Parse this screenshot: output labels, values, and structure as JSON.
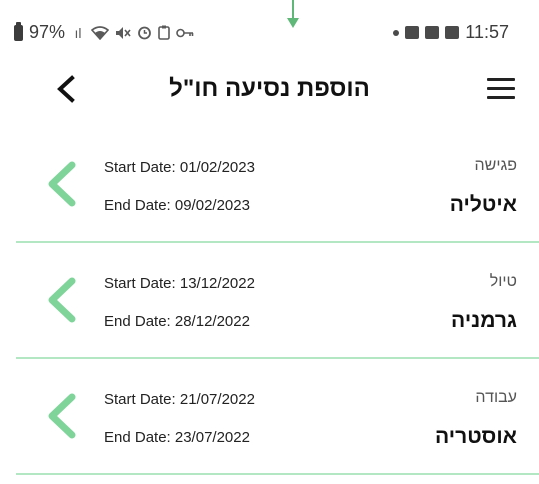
{
  "status_bar": {
    "battery": "97%",
    "time": "11:57"
  },
  "header": {
    "title": "הוספת נסיעה חו\"ל"
  },
  "trips": [
    {
      "type": "פגישה",
      "country": "איטליה",
      "start": "Start Date: 01/02/2023",
      "end": "End Date: 09/02/2023"
    },
    {
      "type": "טיול",
      "country": "גרמניה",
      "start": "Start Date: 13/12/2022",
      "end": "End Date: 28/12/2022"
    },
    {
      "type": "עבודה",
      "country": "אוסטריה",
      "start": "Start Date: 21/07/2022",
      "end": "End Date: 23/07/2022"
    }
  ],
  "colors": {
    "accent": "#7fd49a",
    "divider": "#b3e6c2",
    "text_dark": "#111111"
  },
  "icons": {
    "back": "chevron-left-icon",
    "menu": "hamburger-menu-icon",
    "trip": "chevron-left-icon"
  }
}
